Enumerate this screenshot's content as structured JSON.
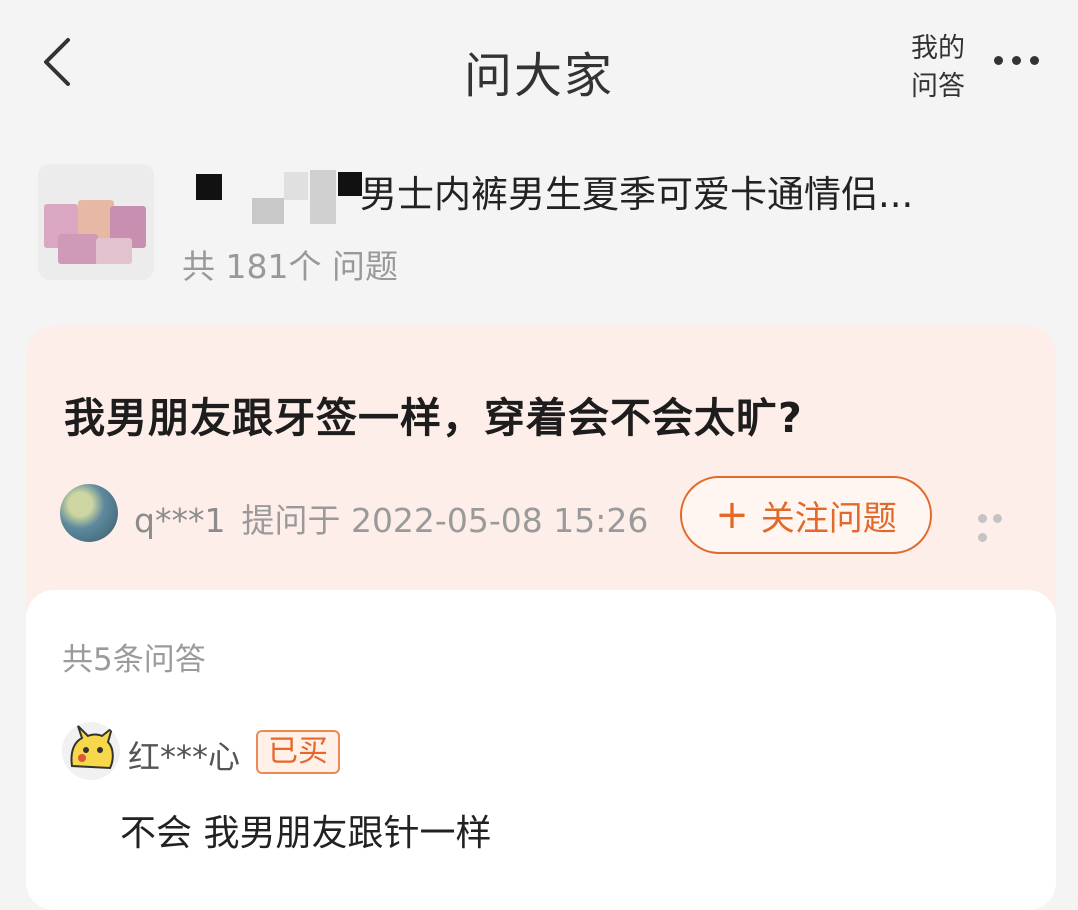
{
  "header": {
    "title": "问大家",
    "my_qa_line1": "我的",
    "my_qa_line2": "问答",
    "back_icon": "chevron-left-icon",
    "more_icon": "more-horizontal-icon"
  },
  "product": {
    "name": "男士内裤男生夏季可爱卡通情侣...",
    "question_count": "共 181个 问题"
  },
  "question": {
    "text": "我男朋友跟牙签一样，穿着会不会太旷?",
    "asker_name": "q***1",
    "asked_time": "提问于 2022-05-08 15:26",
    "follow_label": "关注问题",
    "follow_plus": "+"
  },
  "answers": {
    "count_label": "共5条问答",
    "items": [
      {
        "name": "红***心",
        "badge": "已买",
        "text": "不会 我男朋友跟针一样"
      }
    ]
  },
  "colors": {
    "accent": "#e2692a",
    "question_bg": "#fdeee9",
    "page_bg": "#f4f4f4"
  }
}
